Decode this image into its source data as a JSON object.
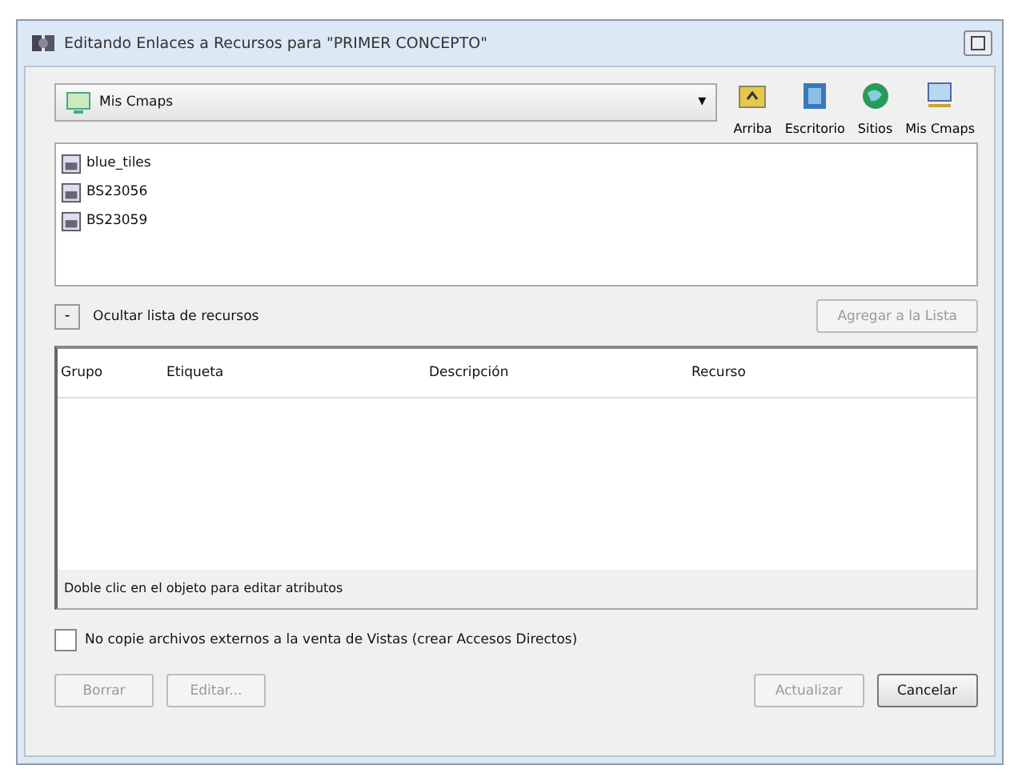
{
  "window": {
    "title": "Editando Enlaces a Recursos para \"PRIMER CONCEPTO\""
  },
  "location": {
    "value": "Mis Cmaps",
    "caret": "▾"
  },
  "nav_buttons": [
    {
      "label": "Arriba",
      "kind": "up"
    },
    {
      "label": "Escritorio",
      "kind": "desktop"
    },
    {
      "label": "Sitios",
      "kind": "sites"
    },
    {
      "label": "Mis Cmaps",
      "kind": "mycmaps"
    }
  ],
  "files": [
    {
      "name": "blue_tiles"
    },
    {
      "name": "BS23056"
    },
    {
      "name": "BS23059"
    }
  ],
  "toggle": {
    "symbol": "-",
    "label": "Ocultar lista de recursos"
  },
  "add_button": {
    "label": "Agregar a la Lista",
    "disabled": true
  },
  "table": {
    "columns": [
      "Grupo",
      "Etiqueta",
      "Descripción",
      "Recurso"
    ],
    "hint": "Doble clic en el objeto para editar atributos"
  },
  "option": {
    "label": "No copie archivos externos a la venta de Vistas (crear Accesos Directos)",
    "checked": false
  },
  "left_buttons": [
    {
      "label": "Borrar",
      "disabled": true
    },
    {
      "label": "Editar...",
      "disabled": true
    }
  ],
  "right_buttons": [
    {
      "label": "Actualizar",
      "disabled": true
    },
    {
      "label": "Cancelar",
      "disabled": false
    }
  ]
}
